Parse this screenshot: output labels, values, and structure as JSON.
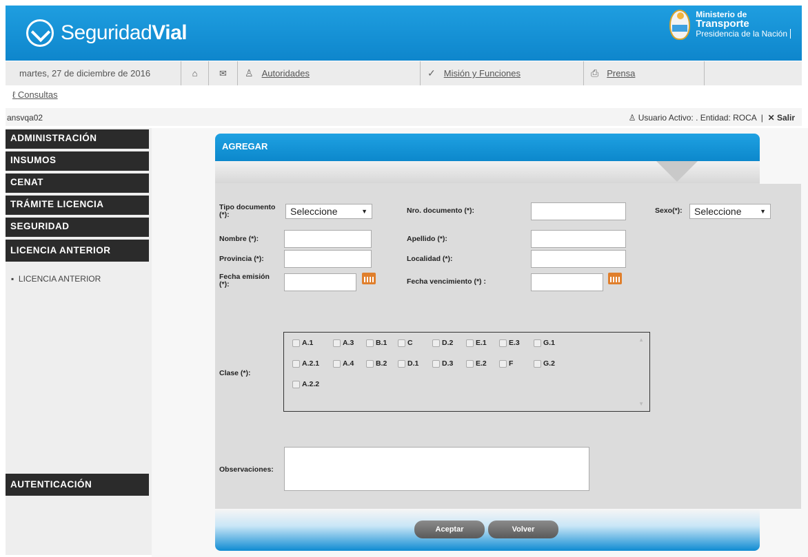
{
  "header": {
    "brand_light": "Seguridad",
    "brand_bold": "Vial",
    "ministry_line1": "Ministerio de",
    "ministry_line2": "Transporte",
    "ministry_line3": "Presidencia de la Nación"
  },
  "topnav": {
    "date": "martes, 27 de diciembre de 2016",
    "autoridades": "Autoridades",
    "mision": "Misión y Funciones",
    "prensa": "Prensa",
    "consultas": "Consultas"
  },
  "userbar": {
    "username": "ansvqa02",
    "status": "Usuario Activo: . Entidad: ROCA",
    "logout": "Salir"
  },
  "sidebar": {
    "items": [
      "ADMINISTRACIÓN",
      "INSUMOS",
      "CENAT",
      "TRÁMITE LICENCIA",
      "SEGURIDAD",
      "LICENCIA ANTERIOR"
    ],
    "sub_item": "LICENCIA ANTERIOR",
    "auth": "AUTENTICACIÓN"
  },
  "form": {
    "title": "AGREGAR",
    "tipo_doc_label": "Tipo documento (*):",
    "tipo_doc_value": "Seleccione",
    "nro_doc_label": "Nro. documento (*):",
    "sexo_label": "Sexo(*):",
    "sexo_value": "Seleccione",
    "nombre_label": "Nombre (*):",
    "apellido_label": "Apellido (*):",
    "provincia_label": "Provincia (*):",
    "localidad_label": "Localidad (*):",
    "fecha_emision_label": "Fecha emisión (*):",
    "fecha_venc_label": "Fecha vencimiento (*) :",
    "clase_label": "Clase (*):",
    "clases_row1": [
      "A.1",
      "A.3",
      "B.1",
      "C",
      "D.2",
      "E.1",
      "E.3",
      "G.1"
    ],
    "clases_row2": [
      "A.2.1",
      "A.4",
      "B.2",
      "D.1",
      "D.3",
      "E.2",
      "F",
      "G.2"
    ],
    "clases_row3": [
      "A.2.2"
    ],
    "observaciones_label": "Observaciones:",
    "accept": "Aceptar",
    "back": "Volver"
  }
}
